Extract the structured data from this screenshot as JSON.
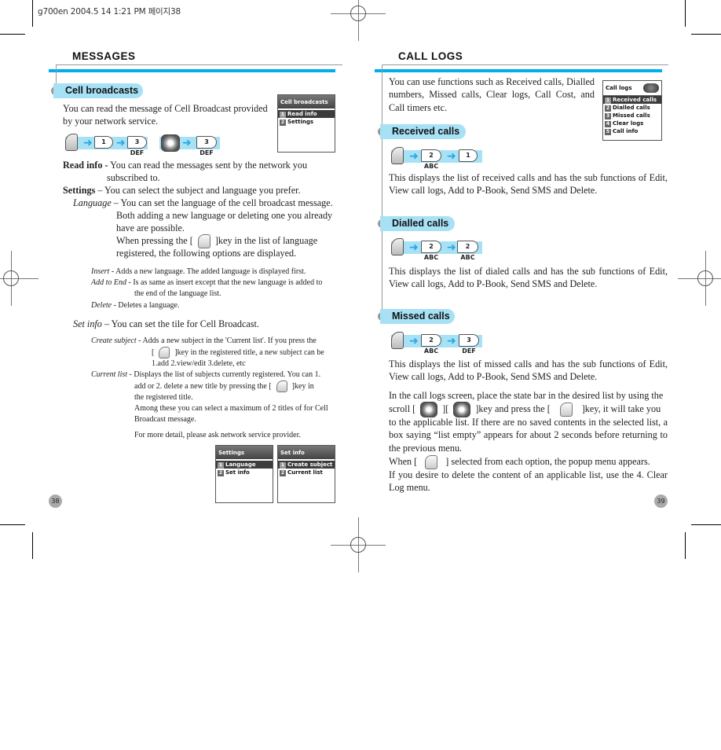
{
  "print_header": "g700en  2004.5 14 1:21 PM 페이지38",
  "left_page": {
    "section_title": "MESSAGES",
    "subsection": "Cell broadcasts",
    "intro": "You can read the message of Cell Broadcast provided by your network service.",
    "key_sequence_1": [
      "menu-key",
      "1",
      "3"
    ],
    "key_sequence_2": [
      "nav-key",
      "3"
    ],
    "keys": {
      "one": "1",
      "three": "3 DEF"
    },
    "screen_cell_broadcasts": {
      "title": "Cell broadcasts",
      "items": [
        {
          "num": "1",
          "label": "Read info",
          "selected": true
        },
        {
          "num": "2",
          "label": "Settings",
          "selected": false
        }
      ]
    },
    "read_info": {
      "term": "Read info -",
      "desc": " You can read the messages sent by the network you",
      "desc2": "subscribed to."
    },
    "settings": {
      "term": "Settings",
      "desc": " – You can select the subject and language you prefer."
    },
    "language": {
      "term": "Language",
      "desc1": " – You can set the language of the cell broadcast message.",
      "desc2": "Both adding a new language or deleting one you already",
      "desc3": "have are possible.",
      "desc4a": "When pressing the [",
      "desc4b": "]key in the list of language",
      "desc5": "registered, the following options are displayed."
    },
    "insert": {
      "term": "Insert",
      "desc": " - Adds a new language. The added language is displayed first."
    },
    "add_to_end": {
      "term": "Add to End",
      "desc": " - Is as same as insert except that the new language is added to",
      "desc2": "the end of the language list."
    },
    "delete": {
      "term": "Delete",
      "desc": " - Deletes a language."
    },
    "set_info": {
      "term": "Set info",
      "desc": "  – You can set the tile for Cell Broadcast."
    },
    "create_subject": {
      "term": "Create subject",
      "desc": " - Adds a new subject in the 'Current list'. If you press the",
      "desc2a": "[",
      "desc2b": "]key in the registered title, a new subject can be",
      "desc3": "1.add 2.view/edit 3.delete, etc"
    },
    "current_list": {
      "term": "Current list",
      "desc": " - Displays the list of subjects currently registered. You can 1.",
      "desc2a": "add or 2. delete a new title by pressing the [",
      "desc2b": "]key in",
      "desc3": "the registered title.",
      "desc4": "Among these you can select a maximum of 2 titles of for Cell",
      "desc5": "Broadcast message."
    },
    "more_detail": "For more detail, please ask network service provider.",
    "screen_settings": {
      "title": "Settings",
      "items": [
        {
          "num": "1",
          "label": "Language",
          "selected": true
        },
        {
          "num": "2",
          "label": "Set info",
          "selected": false
        }
      ]
    },
    "screen_set_info": {
      "title": "Set info",
      "items": [
        {
          "num": "1",
          "label": "Create subject",
          "selected": true
        },
        {
          "num": "2",
          "label": "Current list",
          "selected": false
        }
      ]
    },
    "page_number": "38"
  },
  "right_page": {
    "section_title": "CALL LOGS",
    "intro": "You can use functions such as Received calls, Dialled numbers, Missed calls, Clear logs, Call Cost, and Call timers etc.",
    "screen_call_logs": {
      "title": "Call logs",
      "items": [
        {
          "num": "1",
          "label": "Received calls",
          "selected": true
        },
        {
          "num": "2",
          "label": "Dialled calls",
          "selected": false
        },
        {
          "num": "3",
          "label": "Missed calls",
          "selected": false
        },
        {
          "num": "4",
          "label": "Clear logs",
          "selected": false
        },
        {
          "num": "5",
          "label": "Call info",
          "selected": false
        }
      ]
    },
    "received": {
      "title": "Received calls",
      "keys": [
        "2 ABC",
        "1"
      ],
      "desc": "This displays the list of received calls and has the sub functions of Edit, View call logs, Add to P-Book, Send SMS and Delete."
    },
    "dialled": {
      "title": "Dialled calls",
      "keys": [
        "2 ABC",
        "2 ABC"
      ],
      "desc": "This displays the list of dialed calls and has the sub functions of Edit, View call logs, Add to P-Book, Send SMS and Delete."
    },
    "missed": {
      "title": "Missed calls",
      "keys": [
        "2 ABC",
        "3 DEF"
      ],
      "desc": "This displays the list of missed calls and has the sub functions of Edit, View call logs, Add to P-Book, Send SMS and Delete."
    },
    "scroll_para": {
      "l1": "In the call logs screen, place the state bar in the desired list by using the",
      "l2a": "scroll [",
      "l2b": "][",
      "l2c": "]key and press the [",
      "l2d": "]key, it will take you",
      "rest": "to the applicable list. If there are no saved contents in the selected list, a box saying “list empty” appears for about 2 seconds before returning to the previous menu.",
      "when_a": "When [",
      "when_b": "] selected from each option, the  popup menu appears.",
      "delete": "If you desire to delete the content of an applicable list, use the 4. Clear Log menu."
    },
    "page_number": "39"
  }
}
